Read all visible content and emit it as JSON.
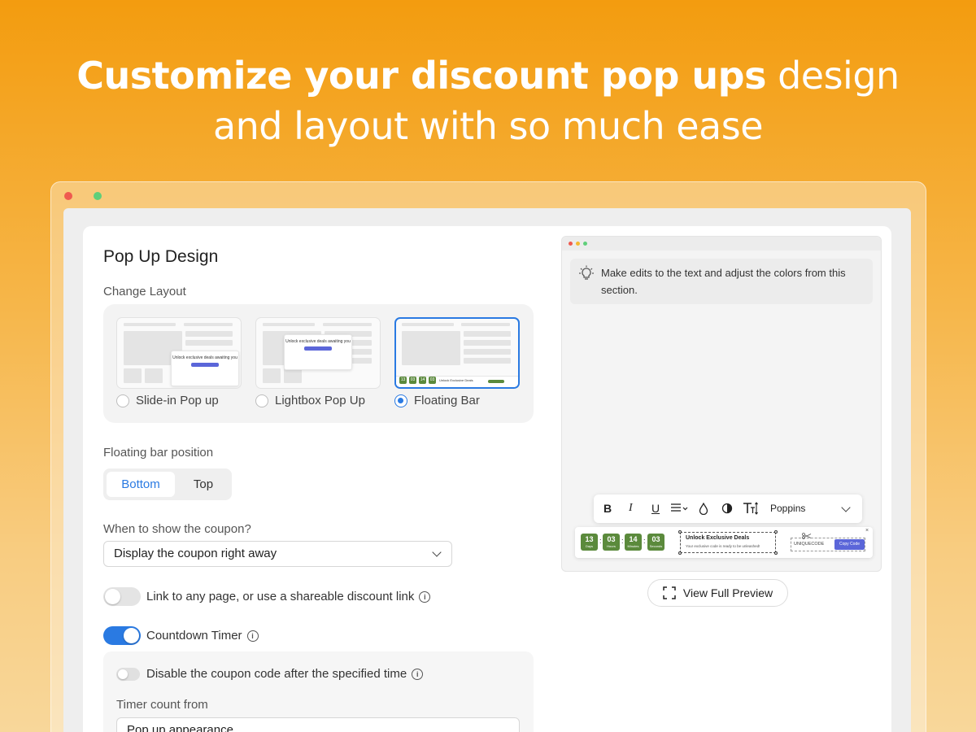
{
  "headline": {
    "bold": "Customize your discount pop ups",
    "light1": " design",
    "light2": "and layout with so much ease"
  },
  "panel": {
    "title": "Pop Up Design",
    "change_layout_label": "Change Layout",
    "layouts": [
      {
        "label": "Slide-in Pop up",
        "selected": false
      },
      {
        "label": "Lightbox Pop Up",
        "selected": false
      },
      {
        "label": "Floating Bar",
        "selected": true
      }
    ],
    "thumb_text": {
      "headline": "Unlock exclusive deals awaiting you",
      "countdown": [
        "13",
        "03",
        "14",
        "03"
      ],
      "bar_title": "Unlock Exclusive Deals"
    },
    "floating_position_label": "Floating bar position",
    "position_options": {
      "bottom": "Bottom",
      "top": "Top",
      "selected": "Bottom"
    },
    "when_show_label": "When to show the coupon?",
    "when_show_value": "Display the coupon right away",
    "link_toggle": {
      "label": "Link to any page, or use a shareable discount link",
      "on": false
    },
    "countdown_toggle": {
      "label": "Countdown Timer",
      "on": true
    },
    "disable_toggle": {
      "label": "Disable the coupon code after the specified time",
      "on": false
    },
    "timer_count_label": "Timer count from",
    "timer_count_value": "Pop up appearance"
  },
  "preview": {
    "tip": "Make edits to the text and adjust the colors from this section.",
    "toolbar": {
      "bold": "B",
      "italic": "I",
      "underline": "U",
      "font": "Poppins"
    },
    "bar": {
      "countdown": [
        {
          "value": "13",
          "unit": "Days"
        },
        {
          "value": "03",
          "unit": "Hours"
        },
        {
          "value": "14",
          "unit": "Minutes"
        },
        {
          "value": "03",
          "unit": "Seconds"
        }
      ],
      "title": "Unlock Exclusive Deals",
      "subtitle": "Your exclusive code is ready to be unleashed!",
      "code": "UNIQUECODE",
      "copy": "Copy Code",
      "close": "×"
    },
    "view_button": "View Full Preview"
  },
  "colors": {
    "accent_blue": "#2a7ae2",
    "countdown_green": "#5b8a3c",
    "copy_purple": "#5b66d9"
  }
}
